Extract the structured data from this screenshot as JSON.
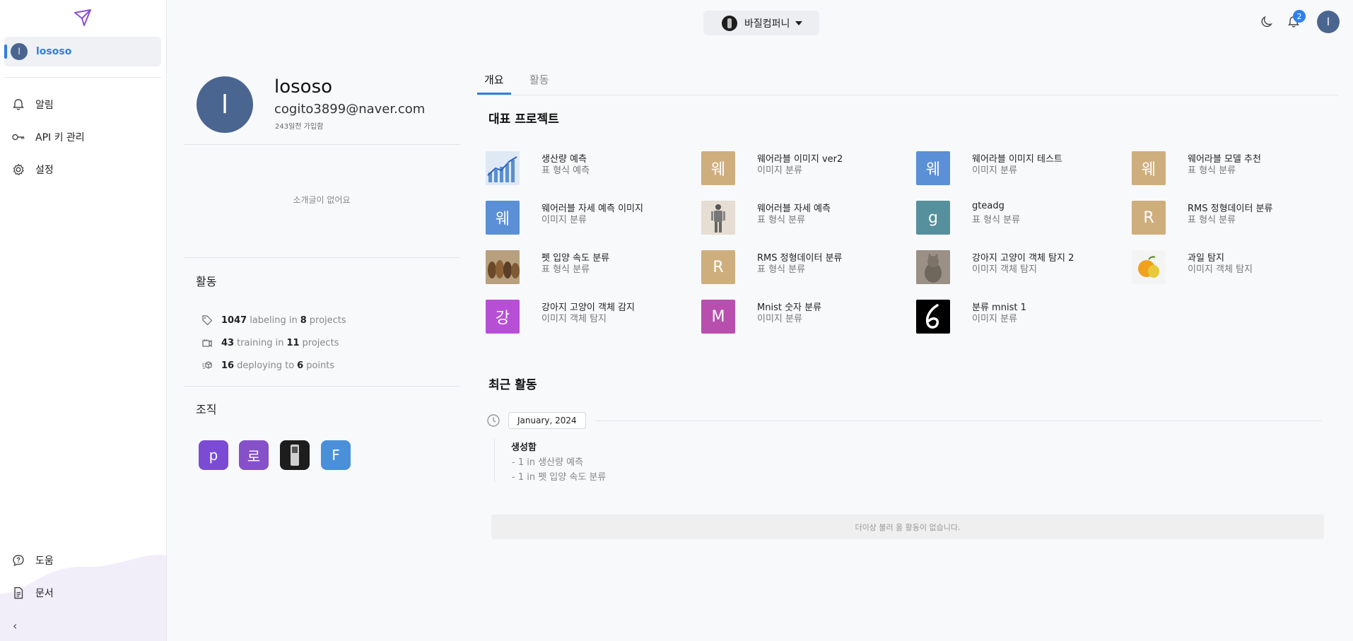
{
  "sidebar": {
    "user_label": "lososo",
    "user_initial": "l",
    "nav": [
      {
        "label": "알림",
        "icon": "bell-icon"
      },
      {
        "label": "API 키 관리",
        "icon": "key-icon"
      },
      {
        "label": "설정",
        "icon": "gear-icon"
      }
    ],
    "bottom": [
      {
        "label": "도움",
        "icon": "help-icon"
      },
      {
        "label": "문서",
        "icon": "document-icon"
      }
    ],
    "collapse_label": "‹",
    "logo_icon": "paper-plane-logo"
  },
  "header": {
    "org_name": "바질컴퍼니",
    "notifications_count": "2",
    "user_initial": "l"
  },
  "profile": {
    "initial": "l",
    "username": "lososo",
    "email": "cogito3899@naver.com",
    "joined": "243일전 가입함",
    "bio": "소개글이 없어요",
    "activity_title": "활동",
    "stats": [
      {
        "count": "1047",
        "verb": "labeling in",
        "count2": "8",
        "unit": "projects",
        "icon": "tag-icon"
      },
      {
        "count": "43",
        "verb": "training in",
        "count2": "11",
        "unit": "projects",
        "icon": "training-icon"
      },
      {
        "count": "16",
        "verb": "deploying to",
        "count2": "6",
        "unit": "points",
        "icon": "deploy-icon"
      }
    ],
    "org_title": "조직",
    "orgs": [
      {
        "letter": "p",
        "color": "#7b4bd6"
      },
      {
        "letter": "로",
        "color": "#8650c8"
      },
      {
        "letter": "",
        "color": "#1d1d1d"
      },
      {
        "letter": "F",
        "color": "#4a90d9"
      }
    ]
  },
  "tabs": [
    {
      "label": "개요",
      "active": true
    },
    {
      "label": "활동",
      "active": false
    }
  ],
  "projects_title": "대표 프로젝트",
  "projects": [
    {
      "name": "생산량 예측",
      "type": "표 형식 예측",
      "thumb": "",
      "color": "#dfe9f5"
    },
    {
      "name": "웨어라블 이미지 ver2",
      "type": "이미지 분류",
      "thumb": "웨",
      "color": "#cfae7e"
    },
    {
      "name": "웨어라블 이미지 테스트",
      "type": "이미지 분류",
      "thumb": "웨",
      "color": "#5b8fd6"
    },
    {
      "name": "웨어라블 모델 추천",
      "type": "표 형식 분류",
      "thumb": "웨",
      "color": "#cfae7e"
    },
    {
      "name": "웨어러블 자세 예측 이미지",
      "type": "이미지 분류",
      "thumb": "웨",
      "color": "#5b8fd6"
    },
    {
      "name": "웨어러블 자세 예측",
      "type": "표 형식 분류",
      "thumb": "",
      "color": "#e6ddd3"
    },
    {
      "name": "gteadg",
      "type": "표 형식 분류",
      "thumb": "g",
      "color": "#56909c"
    },
    {
      "name": "RMS 정형데이터 분류",
      "type": "표 형식 분류",
      "thumb": "R",
      "color": "#cfae7e"
    },
    {
      "name": "펫 입양 속도 분류",
      "type": "표 형식 분류",
      "thumb": "",
      "color": "#a58a6a"
    },
    {
      "name": "RMS 정형데이터 분류",
      "type": "표 형식 분류",
      "thumb": "R",
      "color": "#cfae7e"
    },
    {
      "name": "강아지 고양이 객체 탐지 2",
      "type": "이미지 객체 탐지",
      "thumb": "",
      "color": "#8c8276"
    },
    {
      "name": "과일 탐지",
      "type": "이미지 객체 탐지",
      "thumb": "",
      "color": "#f4f4f4"
    },
    {
      "name": "강아지 고양이 객체 감지",
      "type": "이미지 객체 탐지",
      "thumb": "강",
      "color": "#b74fd6"
    },
    {
      "name": "Mnist 숫자 분류",
      "type": "이미지 분류",
      "thumb": "M",
      "color": "#b84fae"
    },
    {
      "name": "분류 mnist 1",
      "type": "이미지 분류",
      "thumb": "",
      "color": "#000000"
    }
  ],
  "recent": {
    "title": "최근 활동",
    "month": "January, 2024",
    "action": "생성함",
    "lines": [
      "- 1 in 생산량 예측",
      "- 1 in 펫 입양 속도 분류"
    ],
    "no_more": "더이상 불러 올 활동이 없습니다."
  }
}
